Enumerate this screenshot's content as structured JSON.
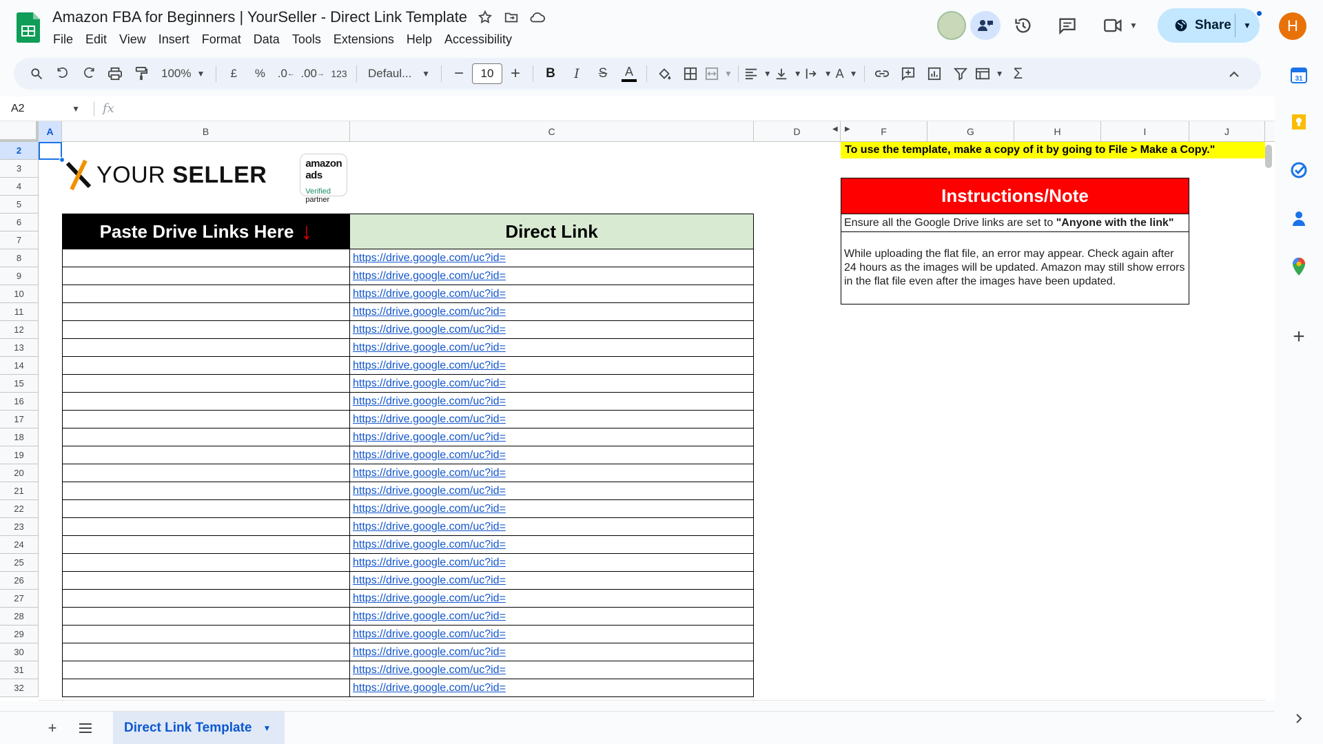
{
  "header": {
    "doc_title": "Amazon FBA for Beginners | YourSeller - Direct Link Template",
    "menu": [
      "File",
      "Edit",
      "View",
      "Insert",
      "Format",
      "Data",
      "Tools",
      "Extensions",
      "Help",
      "Accessibility"
    ],
    "share_label": "Share",
    "user_initial": "H"
  },
  "toolbar": {
    "zoom": "100%",
    "currency": "£",
    "percent": "%",
    "dec_decrease": ".0",
    "dec_increase": ".00",
    "number_format": "123",
    "font": "Defaul...",
    "font_size": "10"
  },
  "formula_bar": {
    "cell_ref": "A2",
    "fx": "fx",
    "value": ""
  },
  "grid": {
    "columns": [
      "A",
      "B",
      "C",
      "D",
      "F",
      "G",
      "H",
      "I",
      "J"
    ],
    "rows": [
      "2",
      "3",
      "4",
      "5",
      "6",
      "7",
      "8",
      "9",
      "10",
      "11",
      "12",
      "13",
      "14",
      "15",
      "16",
      "17",
      "18",
      "19",
      "20",
      "21",
      "22",
      "23",
      "24",
      "25",
      "26",
      "27",
      "28",
      "29",
      "30",
      "31",
      "32"
    ]
  },
  "brand": {
    "name_light": "YOUR ",
    "name_bold": "SELLER",
    "badge_title": "amazon ads",
    "badge_line1": "Verified",
    "badge_line2": "partner"
  },
  "table": {
    "header_b": "Paste Drive Links Here",
    "header_c": "Direct Link",
    "links": [
      "https://drive.google.com/uc?id=",
      "https://drive.google.com/uc?id=",
      "https://drive.google.com/uc?id=",
      "https://drive.google.com/uc?id=",
      "https://drive.google.com/uc?id=",
      "https://drive.google.com/uc?id=",
      "https://drive.google.com/uc?id=",
      "https://drive.google.com/uc?id=",
      "https://drive.google.com/uc?id=",
      "https://drive.google.com/uc?id=",
      "https://drive.google.com/uc?id=",
      "https://drive.google.com/uc?id=",
      "https://drive.google.com/uc?id=",
      "https://drive.google.com/uc?id=",
      "https://drive.google.com/uc?id=",
      "https://drive.google.com/uc?id=",
      "https://drive.google.com/uc?id=",
      "https://drive.google.com/uc?id=",
      "https://drive.google.com/uc?id=",
      "https://drive.google.com/uc?id=",
      "https://drive.google.com/uc?id=",
      "https://drive.google.com/uc?id=",
      "https://drive.google.com/uc?id=",
      "https://drive.google.com/uc?id=",
      "https://drive.google.com/uc?id="
    ]
  },
  "notes": {
    "copy_note": "To use the template, make a copy of it by going to File > Make a Copy.\"",
    "instructions_title": "Instructions/Note",
    "instruction_1_prefix": "Ensure all the Google Drive links are set to ",
    "instruction_1_bold": "\"Anyone with the link\"",
    "instruction_2": "While uploading the flat file, an error may appear. Check again after 24 hours as the images will be updated. Amazon may still show errors in the flat file even after the images have been updated."
  },
  "sheets": {
    "active_tab": "Direct Link Template"
  },
  "colors": {
    "header_black": "#000000",
    "header_green": "#d9ead3",
    "instructions_red": "#ff0000",
    "note_yellow": "#ffff00",
    "link_blue": "#1155cc",
    "share_bg": "#c2e7ff"
  }
}
